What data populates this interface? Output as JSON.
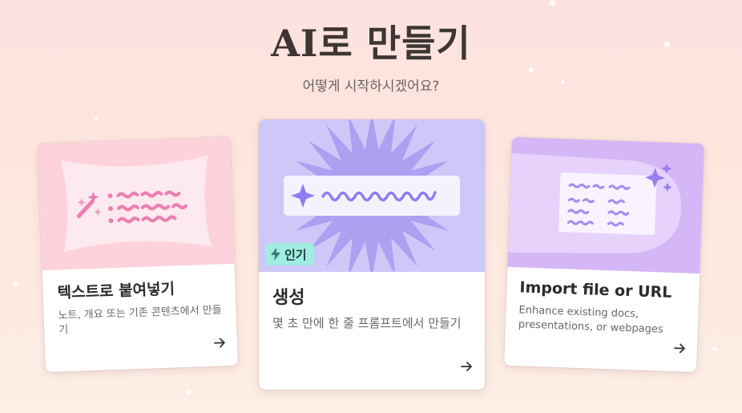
{
  "header": {
    "title": "AI로 만들기",
    "subtitle": "어떻게 시작하시겠어요?"
  },
  "cards": [
    {
      "id": "paste",
      "title": "텍스트로 붙여넣기",
      "description": "노트, 개요 또는 기존 콘텐츠에서 만들기",
      "art_color": "#fdd2da",
      "icon": "magic-wand-icon"
    },
    {
      "id": "generate",
      "title": "생성",
      "description": "몇 초 만에 한 줄 프롬프트에서 만들기",
      "badge": "인기",
      "badge_color": "#9fece1",
      "art_color": "#cdc8f8",
      "icon": "sparkle-icon"
    },
    {
      "id": "import",
      "title": "Import file or URL",
      "description": "Enhance existing docs, presentations, or webpages",
      "art_color": "#d5b6f6",
      "icon": "sparkles-icon"
    }
  ],
  "colors": {
    "background": "#fde2df",
    "title": "#3d3634",
    "accent_purple": "#8f7df0",
    "accent_pink": "#ec7fb2"
  }
}
